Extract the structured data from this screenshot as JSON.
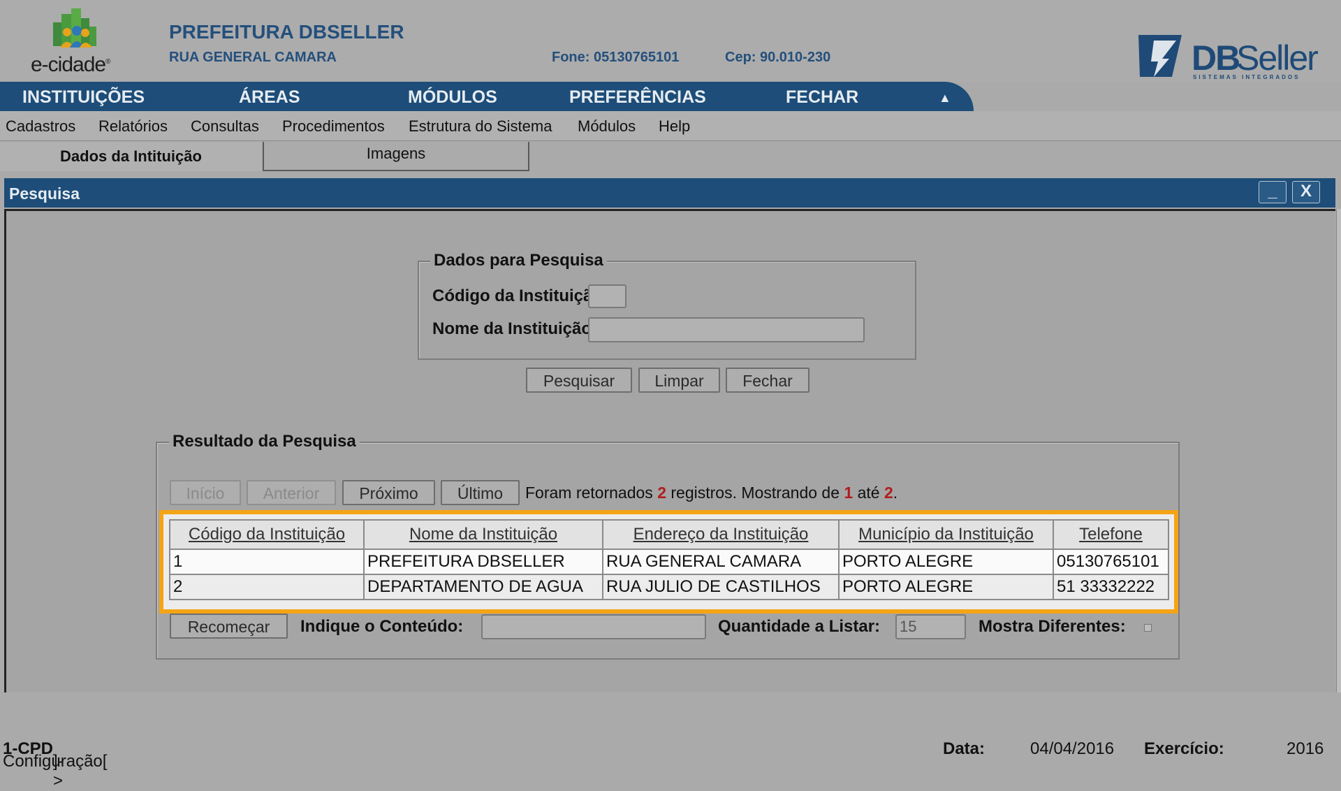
{
  "header": {
    "logo_text": "e-cidade",
    "org_name": "PREFEITURA DBSELLER",
    "street": "RUA GENERAL CAMARA",
    "phone": "Fone: 05130765101",
    "cep": "Cep: 90.010-230",
    "brand_db": "DB",
    "brand_seller": "Seller",
    "brand_sub": "SISTEMAS INTEGRADOS"
  },
  "nav": {
    "items": [
      "INSTITUIÇÕES",
      "ÁREAS",
      "MÓDULOS",
      "PREFERÊNCIAS",
      "FECHAR"
    ],
    "collapse_glyph": "▲"
  },
  "menu": {
    "items": [
      "Cadastros",
      "Relatórios",
      "Consultas",
      "Procedimentos",
      "Estrutura do Sistema",
      "Módulos",
      "Help"
    ]
  },
  "tabs": [
    "Dados da Intituição",
    "Imagens"
  ],
  "window": {
    "title": "Pesquisa",
    "minimize_glyph": "_",
    "close_glyph": "X"
  },
  "search": {
    "legend": "Dados para Pesquisa",
    "code_label": "Código da Instituição:",
    "code_value": "",
    "name_label": "Nome da Instituição:",
    "name_value": "",
    "buttons": [
      "Pesquisar",
      "Limpar",
      "Fechar"
    ]
  },
  "results": {
    "legend": "Resultado da Pesquisa",
    "pager": [
      "Início",
      "Anterior",
      "Próximo",
      "Último"
    ],
    "info_prefix": "Foram retornados",
    "info_count": "2",
    "info_mid": "registros. Mostrando de",
    "info_from": "1",
    "info_until": "até",
    "info_to": "2",
    "info_end": ".",
    "columns": [
      "Código da Instituição",
      "Nome da Instituição",
      "Endereço da Instituição",
      "Município da Instituição",
      "Telefone"
    ],
    "rows": [
      [
        "1",
        "PREFEITURA DBSELLER",
        "RUA GENERAL CAMARA",
        "PORTO ALEGRE",
        "05130765101"
      ],
      [
        "2",
        "DEPARTAMENTO DE AGUA",
        "RUA JULIO DE CASTILHOS",
        "PORTO ALEGRE",
        "51 33332222"
      ]
    ],
    "restart_button": "Recomeçar",
    "content_label": "Indique o Conteúdo:",
    "content_value": "",
    "quantity_label": "Quantidade a Listar:",
    "quantity_value": "15",
    "diff_label": "Mostra Diferentes:",
    "highlight_color": "#f5a416"
  },
  "status": {
    "config_prefix": "Configuração[",
    "config_bold": "1-CPD",
    "config_suffix": "]->",
    "date_label": "Data:",
    "date_value": "04/04/2016",
    "year_label": "Exercício:",
    "year_value": "2016"
  }
}
